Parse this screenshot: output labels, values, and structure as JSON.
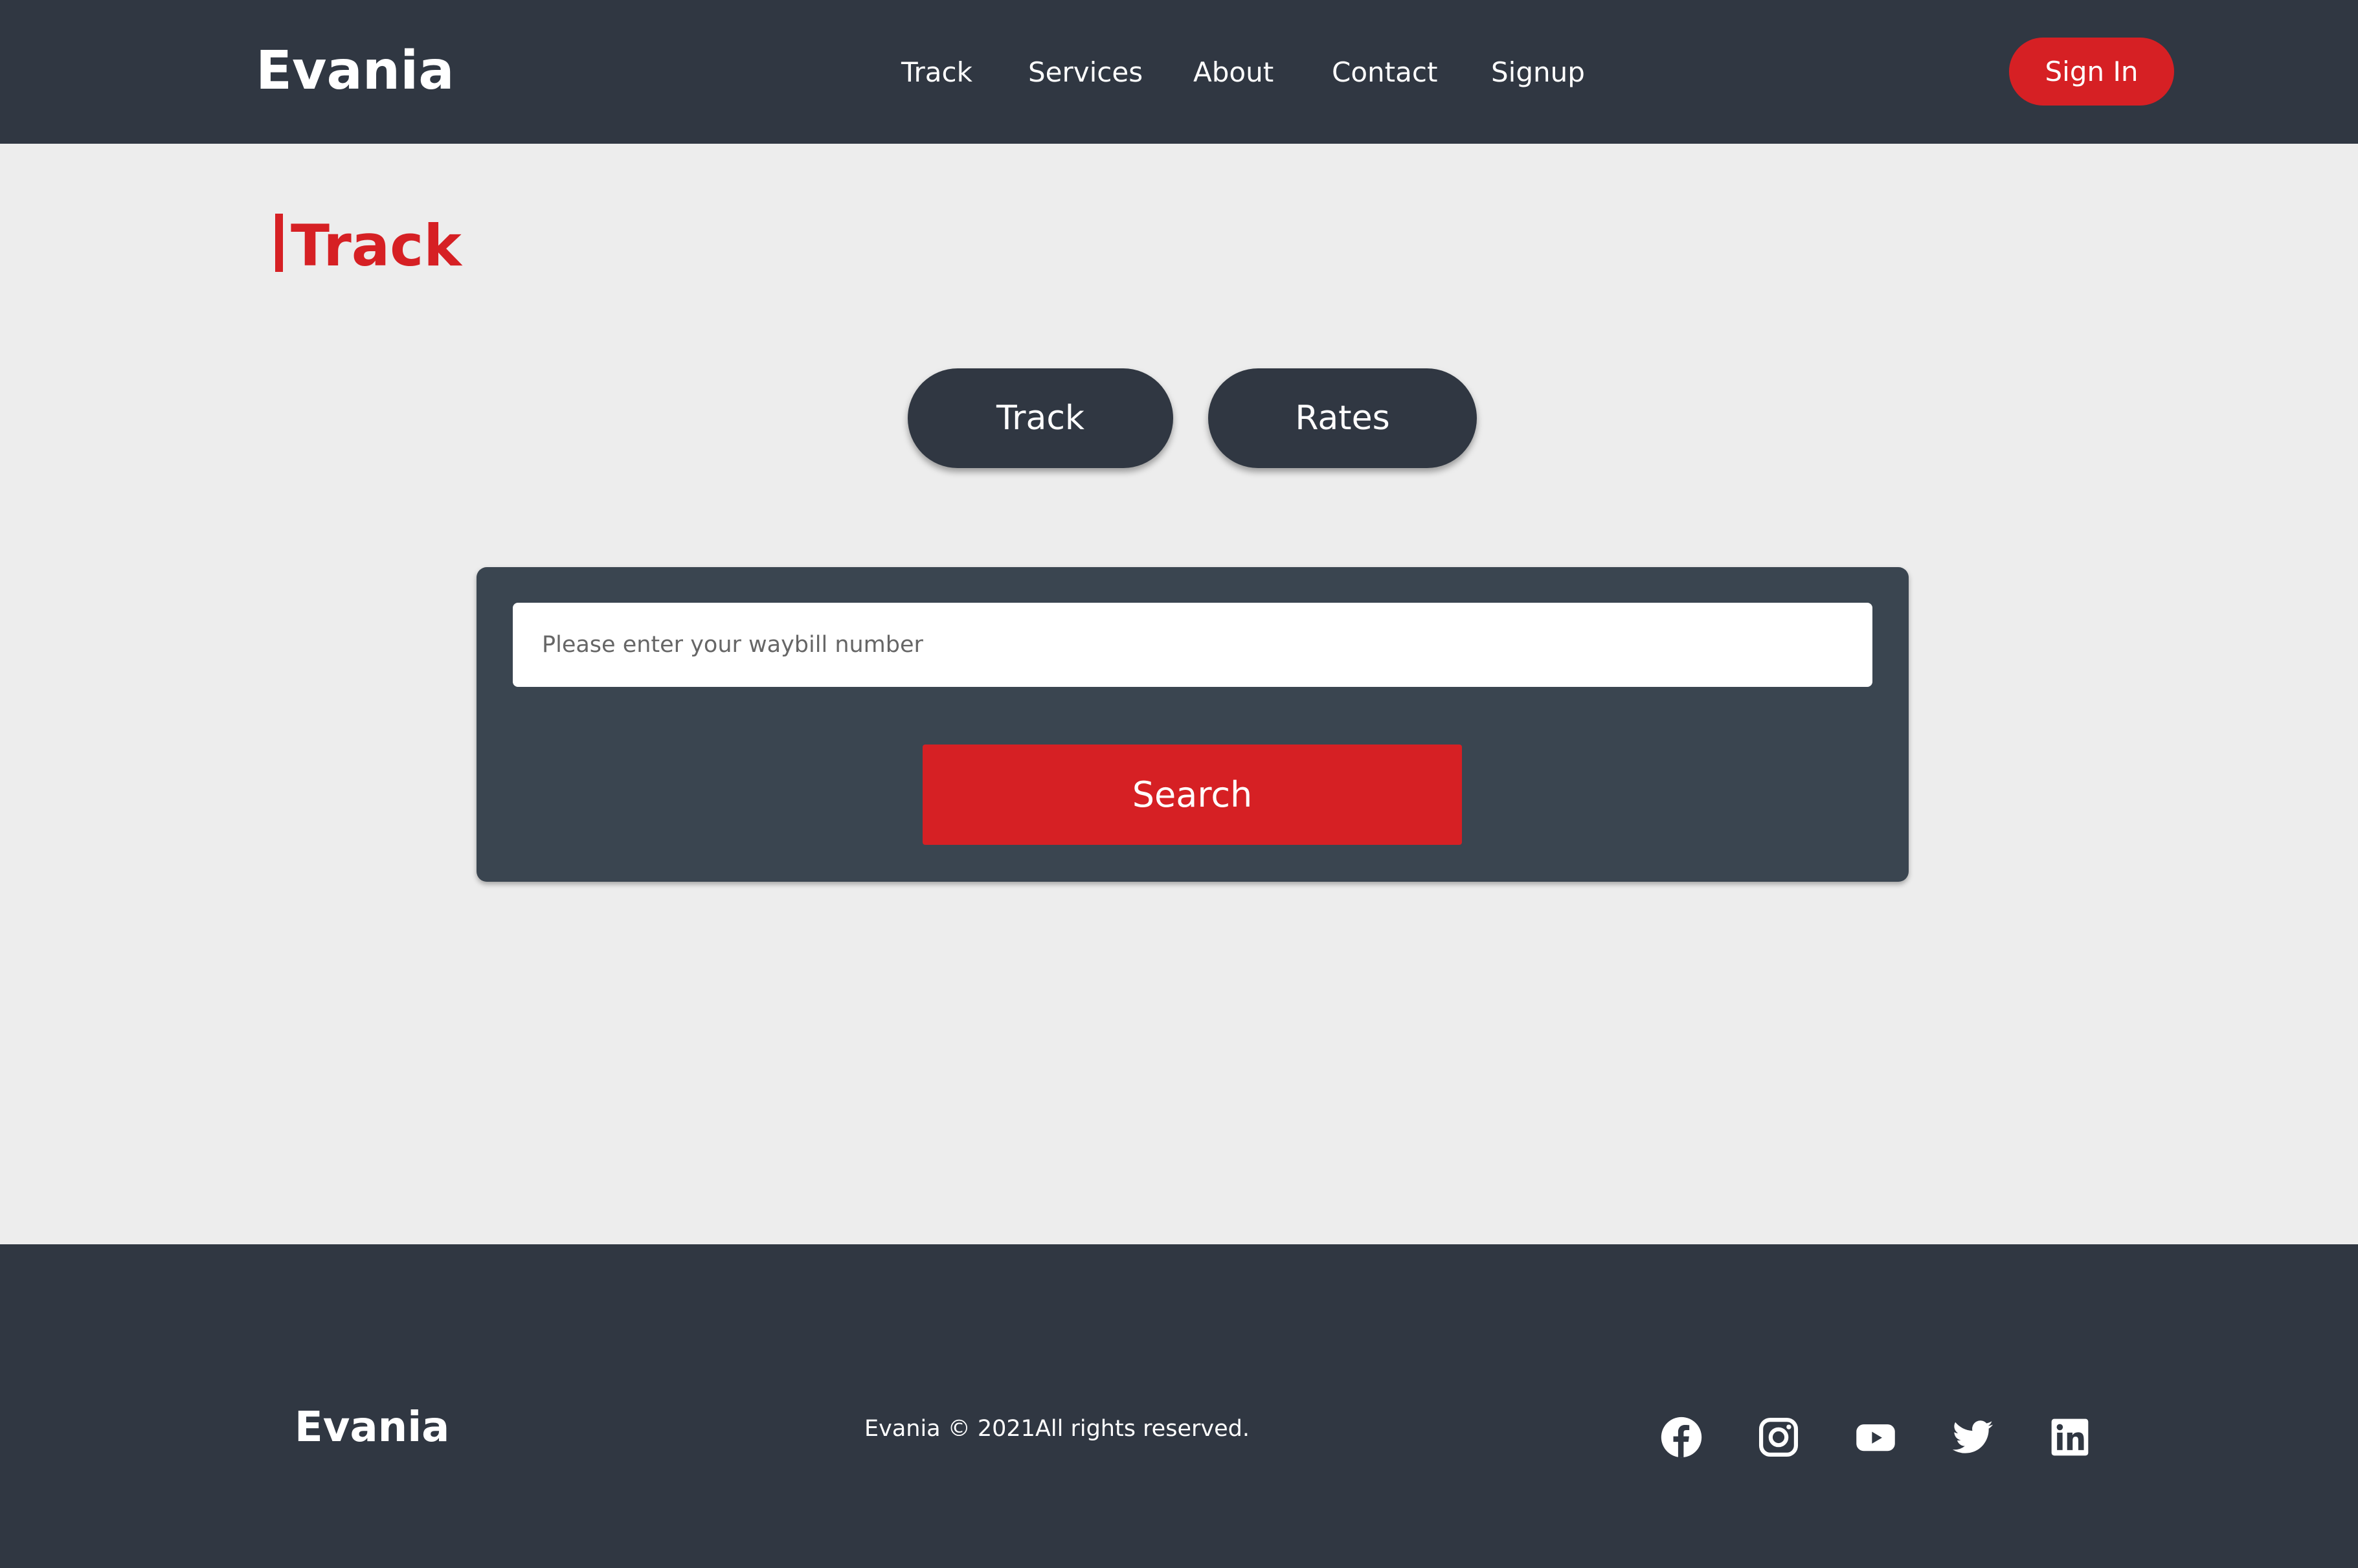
{
  "header": {
    "logo": "Evania",
    "nav": [
      "Track",
      "Services",
      "About",
      "Contact",
      "Signup"
    ],
    "signin": "Sign In"
  },
  "page": {
    "title": "Track"
  },
  "tabs": [
    "Track",
    "Rates"
  ],
  "form": {
    "placeholder": "Please enter your waybill number",
    "value": "",
    "search": "Search"
  },
  "footer": {
    "logo": "Evania",
    "copyright": "Evania © 2021All rights reserved.",
    "social": [
      "facebook",
      "instagram",
      "youtube",
      "twitter",
      "linkedin"
    ]
  },
  "colors": {
    "accent": "#d62024",
    "dark": "#303742",
    "panel": "#3a4550",
    "bg": "#ededed"
  }
}
